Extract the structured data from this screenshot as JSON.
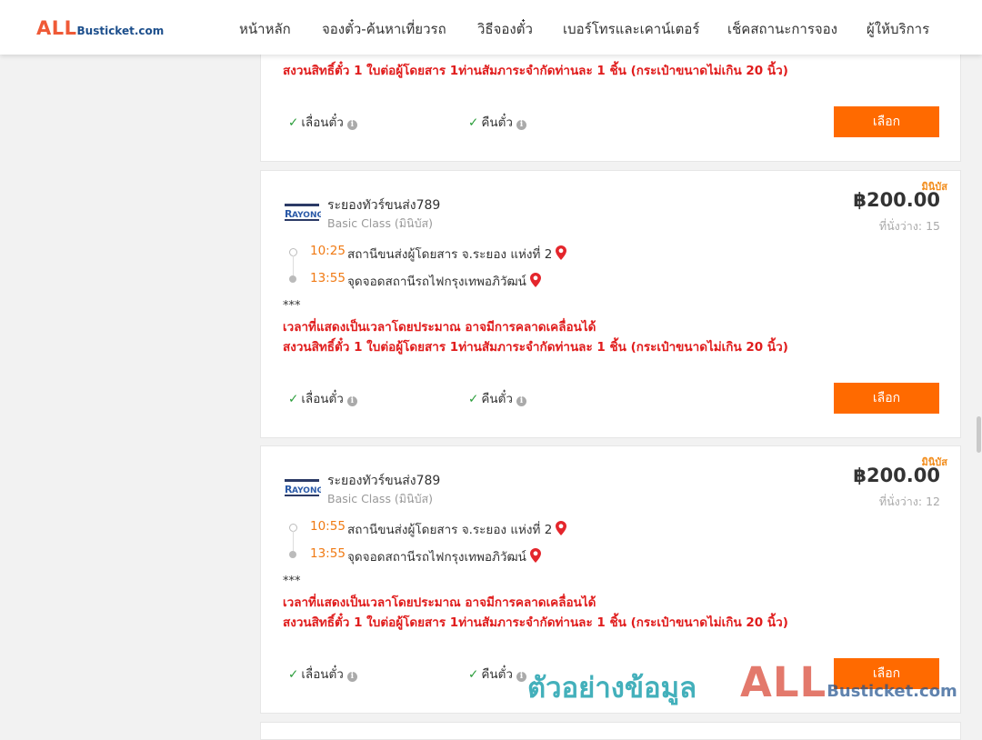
{
  "header": {
    "logo_all": "ALL",
    "logo_rest": "Busticket.com",
    "nav": [
      {
        "id": "home",
        "label": "หน้าหลัก"
      },
      {
        "id": "book",
        "label": "จองตั๋ว-ค้นหาเที่ยวรถ"
      },
      {
        "id": "howto",
        "label": "วิธีจองตั๋ว"
      },
      {
        "id": "contact",
        "label": "เบอร์โทรและเคาน์เตอร์"
      },
      {
        "id": "status",
        "label": "เช็คสถานะการจอง"
      },
      {
        "id": "providers",
        "label": "ผู้ให้บริการ"
      }
    ]
  },
  "common": {
    "stars": "***",
    "note_time": "เวลาที่แสดงเป็นเวลาโดยประมาณ อาจมีการคลาดเคลื่อนได้",
    "note_luggage": "สงวนสิทธิ์ตั๋ว 1 ใบต่อผู้โดยสาร 1ท่านสัมภาระจำกัดท่านละ 1 ชิ้น (กระเป๋าขนาดไม่เกิน 20 นิ้ว)",
    "feature_change": "เลื่อนตั๋ว",
    "feature_refund": "คืนตั๋ว",
    "select_label": "เลือก",
    "info_glyph": "i"
  },
  "cards": [
    {
      "id": "trip-1",
      "tag": "มินิบัส",
      "operator": "ระยองทัวร์ขนส่ง789",
      "class": "Basic Class (มินิบัส)",
      "price": "฿200.00",
      "seats": "ที่นั่งว่าง: 15",
      "dep_time": "10:25",
      "dep_station": "สถานีขนส่งผู้โดยสาร จ.ระยอง แห่งที่ 2",
      "arr_time": "13:55",
      "arr_station": "จุดจอดสถานีรถไฟกรุงเทพอภิวัฒน์"
    },
    {
      "id": "trip-2",
      "tag": "มินิบัส",
      "operator": "ระยองทัวร์ขนส่ง789",
      "class": "Basic Class (มินิบัส)",
      "price": "฿200.00",
      "seats": "ที่นั่งว่าง: 12",
      "dep_time": "10:55",
      "dep_station": "สถานีขนส่งผู้โดยสาร จ.ระยอง แห่งที่ 2",
      "arr_time": "13:55",
      "arr_station": "จุดจอดสถานีรถไฟกรุงเทพอภิวัฒน์"
    }
  ],
  "watermark": {
    "text": "ตัวอย่างข้อมูล",
    "logo_all": "ALL",
    "logo_rest": "Busticket.com"
  },
  "colors": {
    "brand_orange": "#ff6a00",
    "time_orange": "#f07a14",
    "notice_red": "#e01c1c",
    "check_green": "#2a9d3a",
    "pin_red": "#e4262c"
  }
}
